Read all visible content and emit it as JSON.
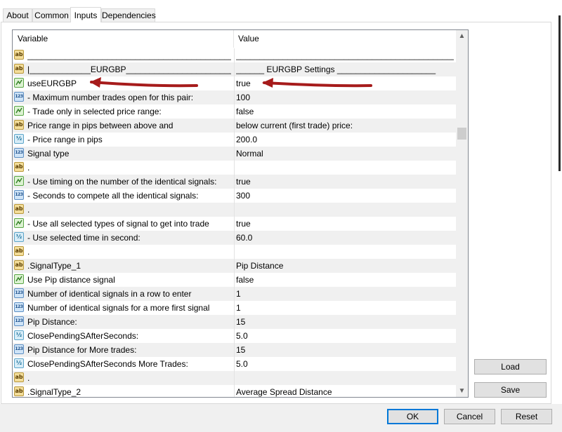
{
  "tabs": [
    {
      "label": "About",
      "active": false
    },
    {
      "label": "Common",
      "active": false
    },
    {
      "label": "Inputs",
      "active": true
    },
    {
      "label": "Dependencies",
      "active": false
    }
  ],
  "grid": {
    "columns": {
      "variable": "Variable",
      "value": "Value"
    },
    "rows": [
      {
        "icon": "ab",
        "name": "_________________________________________________...",
        "value": "___________________________________________________..."
      },
      {
        "icon": "ab",
        "name": "|_____________EURGBP_____________________________...",
        "value": "______ EURGBP Settings _____________________"
      },
      {
        "icon": "bool",
        "name": "useEURGBP",
        "value": "true"
      },
      {
        "icon": "123",
        "name": " - Maximum number trades open for this pair:",
        "value": "100"
      },
      {
        "icon": "bool",
        "name": " - Trade only in selected price range:",
        "value": "false"
      },
      {
        "icon": "ab",
        "name": "Price range in pips between above and",
        "value": "below current (first trade) price:"
      },
      {
        "icon": "half",
        "name": " - Price range in pips",
        "value": "200.0"
      },
      {
        "icon": "123",
        "name": "Signal type",
        "value": "Normal"
      },
      {
        "icon": "ab",
        "name": ".",
        "value": ""
      },
      {
        "icon": "bool",
        "name": " - Use timing on the number of the identical signals:",
        "value": "true"
      },
      {
        "icon": "123",
        "name": " - Seconds to compete all the identical signals:",
        "value": "300"
      },
      {
        "icon": "ab",
        "name": ".",
        "value": ""
      },
      {
        "icon": "bool",
        "name": " - Use all selected types of signal to get into trade",
        "value": "true"
      },
      {
        "icon": "half",
        "name": " - Use selected time in second:",
        "value": "60.0"
      },
      {
        "icon": "ab",
        "name": ".",
        "value": ""
      },
      {
        "icon": "ab",
        "name": ".SignalType_1",
        "value": "Pip Distance"
      },
      {
        "icon": "bool",
        "name": "Use Pip distance signal",
        "value": "false"
      },
      {
        "icon": "123",
        "name": "Number of identical signals in a row to enter",
        "value": "1"
      },
      {
        "icon": "123",
        "name": "Number of identical signals for a more first signal",
        "value": "1"
      },
      {
        "icon": "123",
        "name": "Pip Distance:",
        "value": "15"
      },
      {
        "icon": "half",
        "name": "ClosePendingSAfterSeconds:",
        "value": "5.0"
      },
      {
        "icon": "123",
        "name": "Pip Distance for More trades:",
        "value": "15"
      },
      {
        "icon": "half",
        "name": "ClosePendingSAfterSeconds More Trades:",
        "value": "5.0"
      },
      {
        "icon": "ab",
        "name": ".",
        "value": ""
      },
      {
        "icon": "ab",
        "name": ".SignalType_2",
        "value": "Average Spread Distance"
      }
    ]
  },
  "icons": {
    "ab": "ab",
    "123": "123",
    "half": "½",
    "scroll_up": "▲",
    "scroll_down": "▼"
  },
  "buttons": {
    "load": "Load",
    "save": "Save",
    "ok": "OK",
    "cancel": "Cancel",
    "reset": "Reset"
  },
  "colors": {
    "arrow": "#a61b1b",
    "selected_border": "#0078d7"
  }
}
